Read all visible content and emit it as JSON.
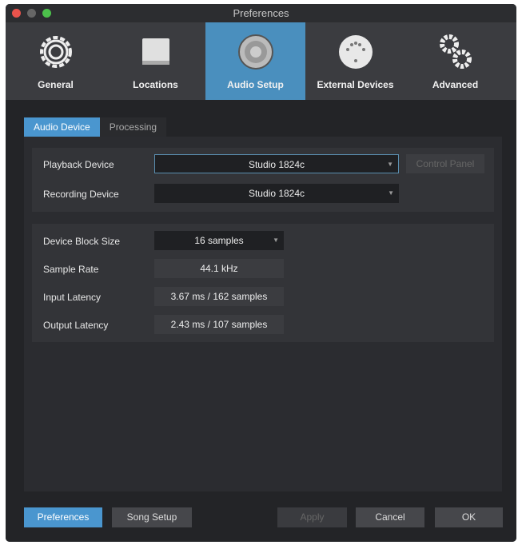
{
  "window": {
    "title": "Preferences"
  },
  "toolbar": [
    {
      "label": "General",
      "icon": "gear-refresh-icon"
    },
    {
      "label": "Locations",
      "icon": "drive-icon"
    },
    {
      "label": "Audio Setup",
      "icon": "speaker-icon"
    },
    {
      "label": "External Devices",
      "icon": "midi-port-icon"
    },
    {
      "label": "Advanced",
      "icon": "gears-icon"
    }
  ],
  "tabs": [
    "Audio Device",
    "Processing"
  ],
  "devices": {
    "playback_label": "Playback Device",
    "playback_value": "Studio 1824c",
    "recording_label": "Recording Device",
    "recording_value": "Studio 1824c",
    "control_panel": "Control Panel"
  },
  "settings": {
    "block_label": "Device Block Size",
    "block_value": "16 samples",
    "rate_label": "Sample Rate",
    "rate_value": "44.1 kHz",
    "input_label": "Input Latency",
    "input_value": "3.67 ms / 162 samples",
    "output_label": "Output Latency",
    "output_value": "2.43 ms / 107 samples"
  },
  "footer": {
    "preferences": "Preferences",
    "song_setup": "Song Setup",
    "apply": "Apply",
    "cancel": "Cancel",
    "ok": "OK"
  },
  "colors": {
    "accent": "#4a8fbe"
  }
}
